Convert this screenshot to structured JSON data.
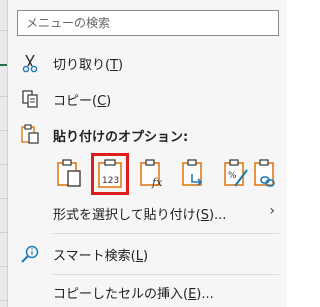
{
  "search": {
    "placeholder": "メニューの検索"
  },
  "menu": {
    "cut": {
      "label": "切り取り(",
      "key": "T",
      "tail": ")"
    },
    "copy": {
      "label": "コピー(",
      "key": "C",
      "tail": ")"
    },
    "paste_options_title": "貼り付けのオプション:",
    "paste_options": [
      {
        "name": "paste",
        "selected": false
      },
      {
        "name": "paste-values",
        "text": "123",
        "selected": true
      },
      {
        "name": "paste-formulas",
        "text": "fx",
        "selected": false
      },
      {
        "name": "paste-transpose",
        "selected": false
      },
      {
        "name": "paste-formatting",
        "selected": false
      },
      {
        "name": "paste-link",
        "selected": false
      }
    ],
    "paste_special": {
      "label": "形式を選択して貼り付け(",
      "key": "S",
      "tail": ")..."
    },
    "smart_lookup": {
      "label": "スマート検索(",
      "key": "L",
      "tail": ")"
    },
    "insert_copied": {
      "label": "コピーしたセルの挿入(",
      "key": "E",
      "tail": ")..."
    }
  },
  "colors": {
    "accent": "#e07b17",
    "highlight": "#e01c1c",
    "link": "#1f7ab8"
  }
}
